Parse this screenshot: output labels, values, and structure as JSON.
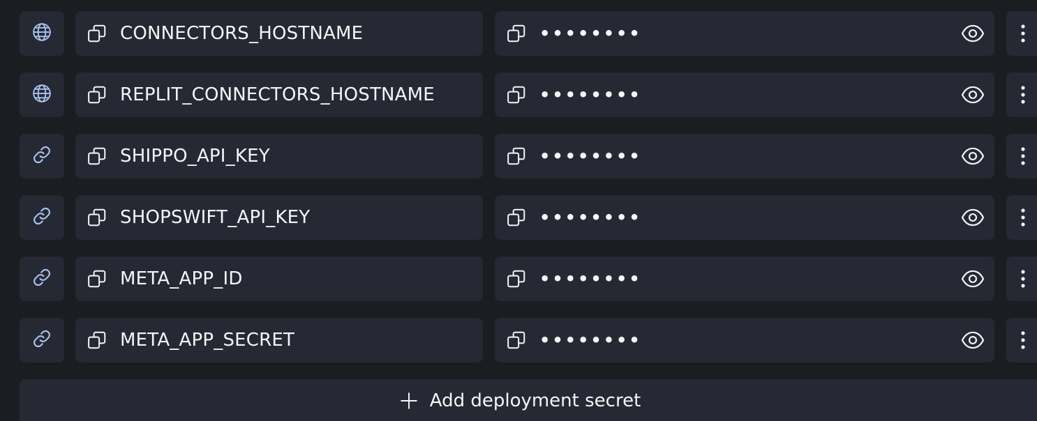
{
  "secrets": [
    {
      "type_icon": "globe-icon",
      "key": "CONNECTORS_HOSTNAME",
      "masked_value": "••••••••"
    },
    {
      "type_icon": "globe-icon",
      "key": "REPLIT_CONNECTORS_HOSTNAME",
      "masked_value": "••••••••"
    },
    {
      "type_icon": "link-icon",
      "key": "SHIPPO_API_KEY",
      "masked_value": "••••••••"
    },
    {
      "type_icon": "link-icon",
      "key": "SHOPSWIFT_API_KEY",
      "masked_value": "••••••••"
    },
    {
      "type_icon": "link-icon",
      "key": "META_APP_ID",
      "masked_value": "••••••••"
    },
    {
      "type_icon": "link-icon",
      "key": "META_APP_SECRET",
      "masked_value": "••••••••"
    }
  ],
  "add_button": {
    "label": "Add deployment secret",
    "icon": "plus-icon"
  },
  "colors": {
    "background": "#1c1d23",
    "tile": "#262833",
    "text": "#f5f6f8",
    "type_icon": "#a8c4f0"
  }
}
